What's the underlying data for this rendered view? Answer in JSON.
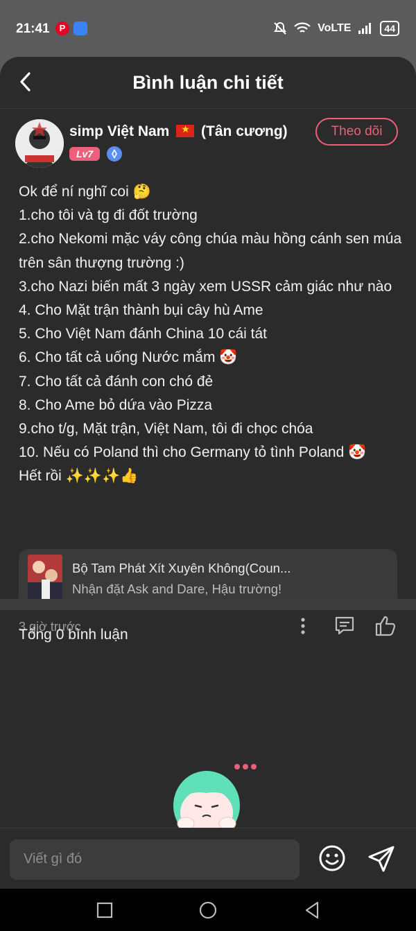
{
  "status_bar": {
    "time": "21:41",
    "pinterest_icon_letter": "P",
    "network": "VoLTE",
    "battery": "44"
  },
  "header": {
    "title": "Bình luận chi tiết",
    "back_icon": "chevron-left-icon"
  },
  "post": {
    "username_prefix": "simp Việt Nam",
    "username_suffix": "(Tân cương)",
    "level": "Lv7",
    "follow_label": "Theo dõi",
    "lines": [
      "Ok để ní nghĩ coi 🤔",
      "1.cho tôi và tg đi đốt trường",
      "2.cho Nekomi mặc váy công chúa màu hồng cánh sen múa trên sân thượng trường :)",
      "3.cho Nazi biến mất 3 ngày xem USSR cảm giác như nào",
      "4. Cho Mặt trận thành bụi cây hù Ame",
      "5. Cho Việt Nam đánh China 10 cái tát",
      "6. Cho tất cả uống Nước mắm 🤡",
      "7. Cho tất cả đánh con chó đẻ",
      "8. Cho Ame bỏ dứa vào Pizza",
      "9.cho t/g, Mặt trận, Việt Nam, tôi đi chọc chóa",
      "10. Nếu có Poland thì cho Germany tỏ tình Poland 🤡",
      "Hết rồi ✨✨✨👍"
    ],
    "novel_title": "Bộ Tam Phát Xít Xuyên Không(Coun...",
    "novel_subtitle": "Nhận đặt Ask and Dare, Hậu trường!",
    "time_ago": "3 giờ trước"
  },
  "comments": {
    "total_label": "Tổng 0 bình luận"
  },
  "composer": {
    "placeholder": "Viết gì đó"
  },
  "colors": {
    "accent": "#ee5f7b",
    "background": "#2b2b2b",
    "card": "#3a3a3a"
  }
}
